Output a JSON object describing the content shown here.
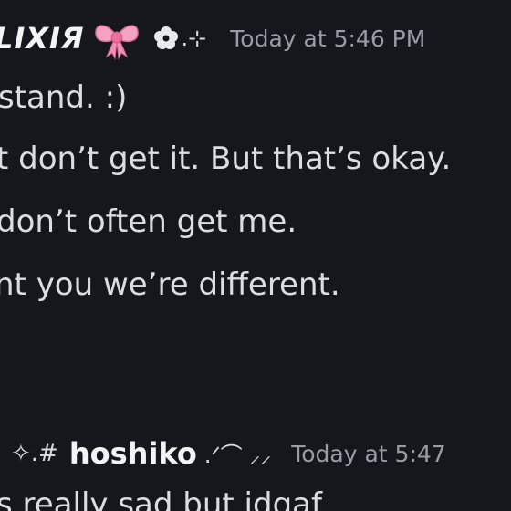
{
  "messages": [
    {
      "author": {
        "name": "LIXIЯ",
        "badge_icon": "pink-bow-icon",
        "suffix_icon": "flower-icon",
        "suffix_text": ".⊹"
      },
      "timestamp": "Today at 5:46 PM",
      "lines": [
        "stand. :)",
        "t don’t get it. But that’s okay.",
        " don’t often get me.",
        "nt you we’re different."
      ]
    },
    {
      "author": {
        "prefix_text": "✧.#",
        "name": "hoshiko",
        "suffix_text": ".ᐟ⌒ ⸝⸝"
      },
      "timestamp": "Today at 5:47",
      "lines": [
        "s really sad but idgaf"
      ]
    }
  ],
  "colors": {
    "background": "#16171c",
    "username": "#f2f3f5",
    "text": "#dcdde1",
    "timestamp": "#9a9ca5",
    "bow_pink": "#f28fb2"
  }
}
